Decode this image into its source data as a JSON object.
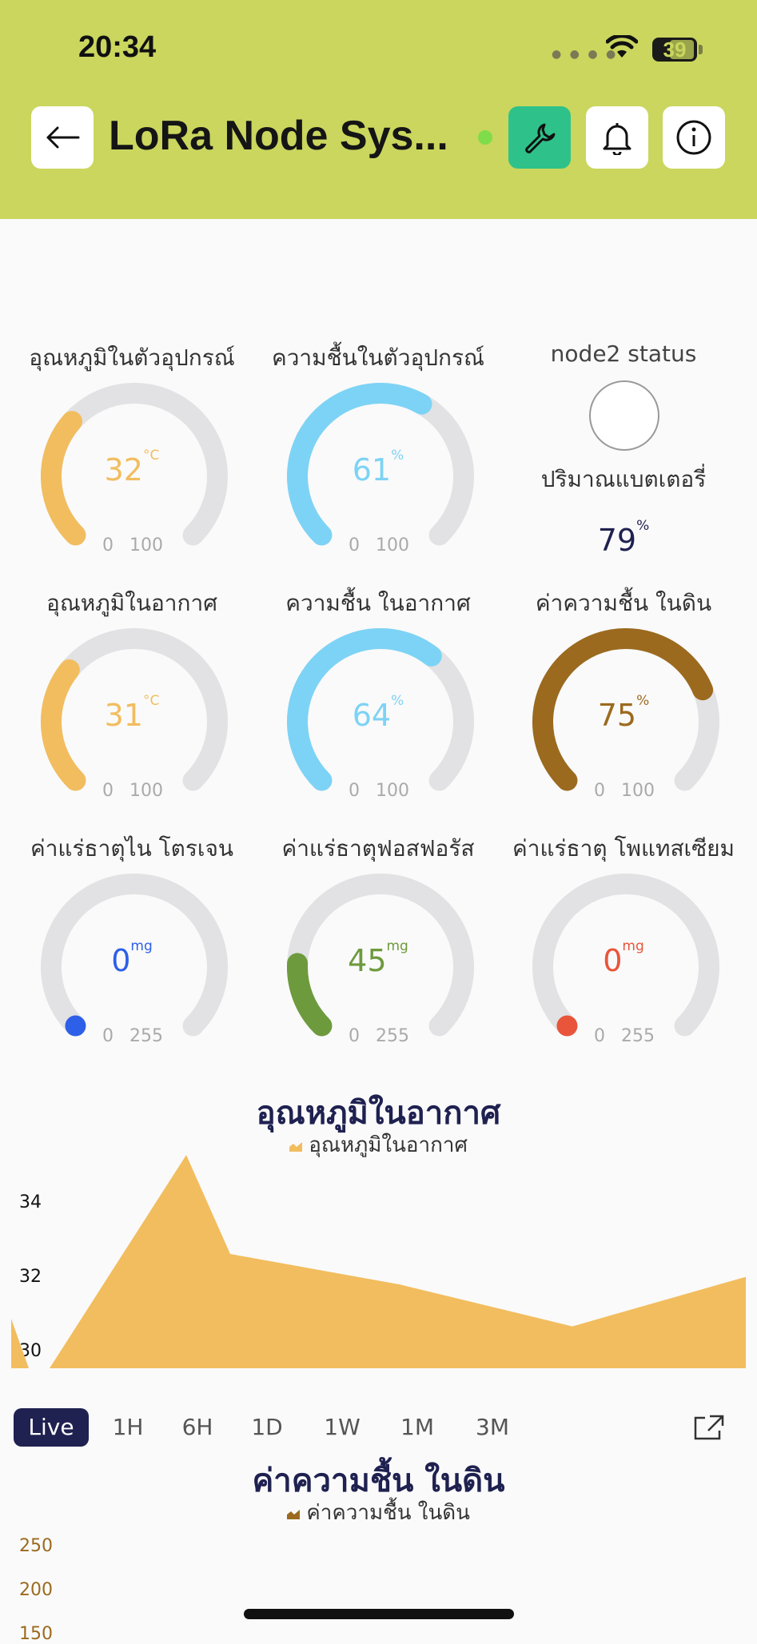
{
  "status_bar": {
    "time": "20:34",
    "battery": "39"
  },
  "header": {
    "title": "LoRa Node Sys..."
  },
  "gauges": [
    {
      "label": "อุณหภูมิในตัวอุปกรณ์",
      "value": "32",
      "unit": "°C",
      "min": "0",
      "max": "100",
      "fraction": 0.32,
      "color": "#f2bd5f"
    },
    {
      "label": "ความชื้นในตัวอุปกรณ์",
      "value": "61",
      "unit": "%",
      "min": "0",
      "max": "100",
      "fraction": 0.61,
      "color": "#7dd3f5"
    },
    {
      "label": "อุณหภูมิในอากาศ",
      "value": "31",
      "unit": "°C",
      "min": "0",
      "max": "100",
      "fraction": 0.31,
      "color": "#f2bd5f"
    },
    {
      "label": "ความชื้น ในอากาศ",
      "value": "64",
      "unit": "%",
      "min": "0",
      "max": "100",
      "fraction": 0.64,
      "color": "#7dd3f5"
    },
    {
      "label": "ค่าความชื้น ในดิน",
      "value": "75",
      "unit": "%",
      "min": "0",
      "max": "100",
      "fraction": 0.75,
      "color": "#9b6a1f"
    },
    {
      "label": "ค่าแร่ธาตุไน โตรเจน",
      "value": "0",
      "unit": "mg",
      "min": "0",
      "max": "255",
      "fraction": 0,
      "color": "#2e5fe8"
    },
    {
      "label": "ค่าแร่ธาตุฟอสฟอรัส",
      "value": "45",
      "unit": "mg",
      "min": "0",
      "max": "255",
      "fraction": 0.176,
      "color": "#6e9a3e"
    },
    {
      "label": "ค่าแร่ธาตุ โพแทสเซียม",
      "value": "0",
      "unit": "mg",
      "min": "0",
      "max": "255",
      "fraction": 0,
      "color": "#e8553a"
    }
  ],
  "node_status": {
    "label": "node2 status",
    "battery_label": "ปริมาณแบตเตอรี่",
    "battery_value": "79",
    "battery_unit": "%"
  },
  "chart1": {
    "title": "อุณหภูมิในอากาศ",
    "legend": "อุณหภูมิในอากาศ"
  },
  "chart2": {
    "title": "ค่าความชื้น ในดิน",
    "legend": "ค่าความชื้น ในดิน"
  },
  "time_ranges": [
    "Live",
    "1H",
    "6H",
    "1D",
    "1W",
    "1M",
    "3M"
  ],
  "colors": {
    "header": "#cad65d",
    "accent_button": "#2ec28a",
    "chart_fill": "#f2bd5f",
    "title_navy": "#1f2150"
  },
  "chart_data": [
    {
      "type": "area",
      "title": "อุณหภูมิในอากาศ",
      "series": [
        {
          "name": "อุณหภูมิในอากาศ",
          "values": [
            30.3,
            29.0,
            34.6,
            32.0,
            31.2,
            30.1,
            31.4
          ]
        }
      ],
      "yticks": [
        "30",
        "32",
        "34"
      ],
      "ylim": [
        29,
        35
      ],
      "legend_position": "top-center"
    },
    {
      "type": "area",
      "title": "ค่าความชื้น ในดิน",
      "series": [
        {
          "name": "ค่าความชื้น ในดิน",
          "values": []
        }
      ],
      "yticks": [
        "150",
        "200",
        "250"
      ],
      "legend_position": "top-center"
    }
  ]
}
